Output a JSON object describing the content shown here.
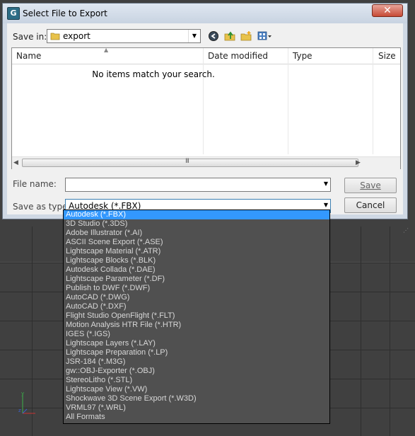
{
  "dialog": {
    "title": "Select File to Export",
    "app_icon_letter": "G",
    "close_glyph": "✕"
  },
  "savein": {
    "label": "Save in:",
    "value": "export"
  },
  "toolbar": {
    "icons": [
      "back-icon",
      "up-folder-icon",
      "new-folder-icon",
      "view-menu-icon"
    ]
  },
  "list": {
    "columns": [
      "Name",
      "Date modified",
      "Type",
      "Size"
    ],
    "empty_message": "No items match your search.",
    "scroll_grip": "III"
  },
  "filename": {
    "label": "File name:",
    "value": ""
  },
  "savetype": {
    "label": "Save as type:",
    "value": "Autodesk (*.FBX)"
  },
  "buttons": {
    "save": "Save",
    "cancel": "Cancel"
  },
  "type_options": [
    "Autodesk (*.FBX)",
    "3D Studio (*.3DS)",
    "Adobe Illustrator (*.AI)",
    "ASCII Scene Export (*.ASE)",
    "Lightscape Material (*.ATR)",
    "Lightscape Blocks (*.BLK)",
    "Autodesk Collada (*.DAE)",
    "Lightscape Parameter (*.DF)",
    "Publish to DWF (*.DWF)",
    "AutoCAD (*.DWG)",
    "AutoCAD (*.DXF)",
    "Flight Studio OpenFlight (*.FLT)",
    "Motion Analysis HTR File (*.HTR)",
    "IGES (*.IGS)",
    "Lightscape Layers (*.LAY)",
    "Lightscape Preparation (*.LP)",
    "JSR-184 (*.M3G)",
    "gw::OBJ-Exporter (*.OBJ)",
    "StereoLitho (*.STL)",
    "Lightscape View (*.VW)",
    "Shockwave 3D Scene Export (*.W3D)",
    "VRML97 (*.WRL)",
    "All Formats"
  ],
  "selected_type_index": 0,
  "colors": {
    "selection": "#3398fe",
    "list_background": "#505050",
    "viewport": "#404040"
  }
}
